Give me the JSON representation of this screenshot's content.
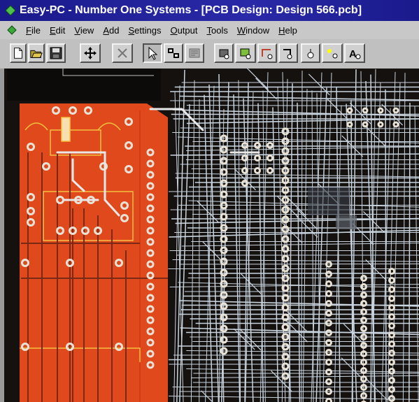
{
  "window": {
    "title": "Easy-PC - Number One Systems - [PCB Design: Design 566.pcb]"
  },
  "menu": [
    {
      "pre": "",
      "acc": "F",
      "post": "ile"
    },
    {
      "pre": "",
      "acc": "E",
      "post": "dit"
    },
    {
      "pre": "",
      "acc": "V",
      "post": "iew"
    },
    {
      "pre": "",
      "acc": "A",
      "post": "dd"
    },
    {
      "pre": "",
      "acc": "S",
      "post": "ettings"
    },
    {
      "pre": "",
      "acc": "O",
      "post": "utput"
    },
    {
      "pre": "",
      "acc": "T",
      "post": "ools"
    },
    {
      "pre": "",
      "acc": "W",
      "post": "indow"
    },
    {
      "pre": "",
      "acc": "H",
      "post": "elp"
    }
  ],
  "toolbar": {
    "buttons": [
      "new-icon",
      "open-icon",
      "save-icon",
      "move-icon",
      "delete-icon",
      "select-pointer-icon",
      "query-icon",
      "properties-icon",
      "add-component-icon",
      "add-pad-icon",
      "add-track-icon",
      "add-via-icon",
      "add-shape-icon",
      "route-icon",
      "add-text-icon"
    ]
  },
  "colors": {
    "titlebar": "#1a1a8c",
    "copper_top": "#e0491c",
    "copper_bottom": "#c9d4de",
    "board_bg": "#14110f",
    "pad": "#e9e2d6",
    "silkscreen": "#f2d04a"
  }
}
